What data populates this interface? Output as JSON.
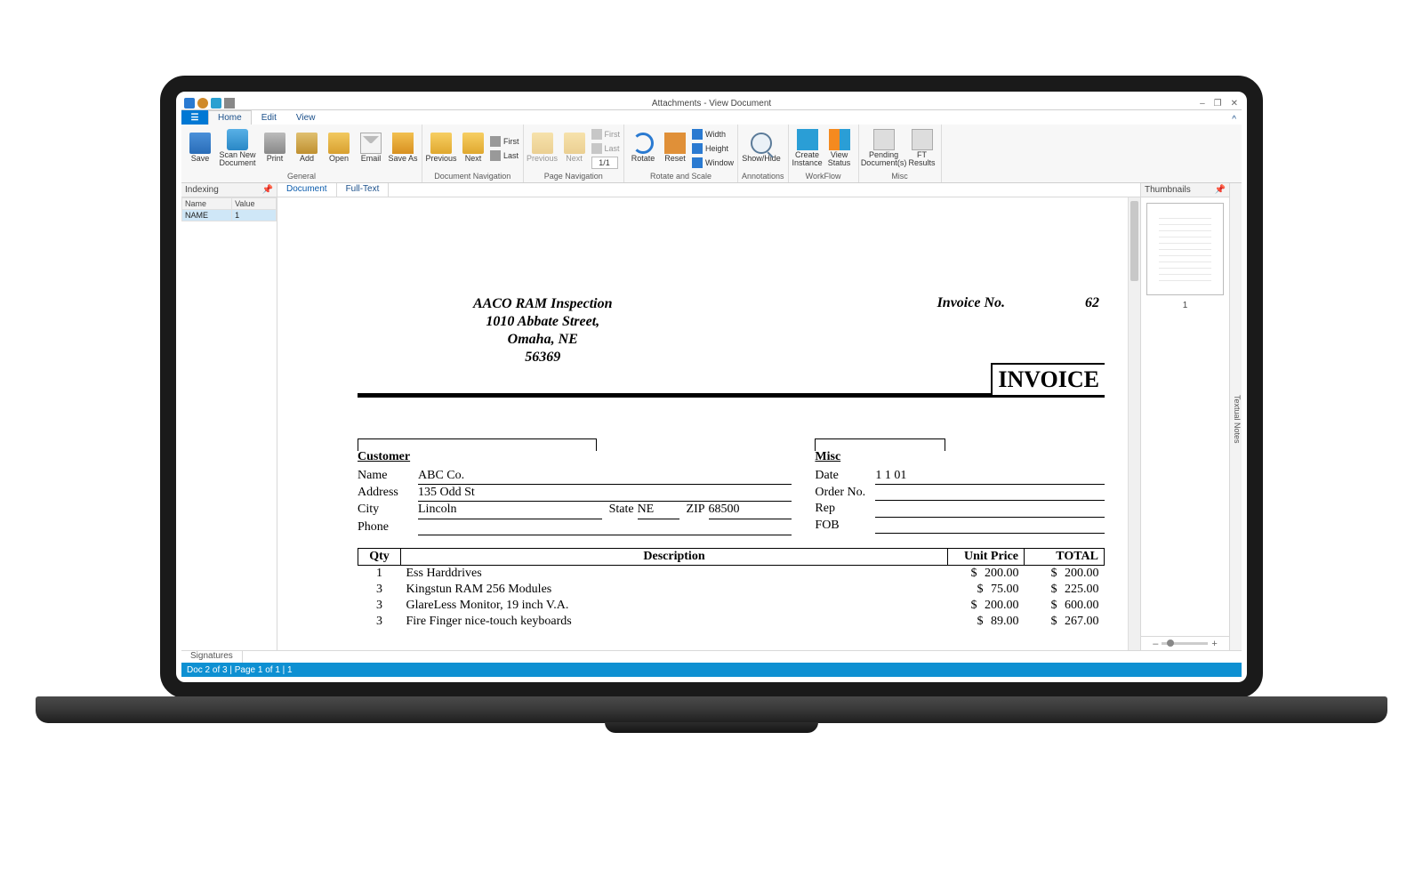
{
  "window": {
    "title": "Attachments - View Document",
    "minimize": "–",
    "maximize": "❐",
    "close": "✕",
    "help_icon": "^"
  },
  "ribbon": {
    "tabs": {
      "home": "Home",
      "edit": "Edit",
      "view": "View"
    },
    "general": {
      "label": "General",
      "save": "Save",
      "scan_new_document": "Scan New\nDocument",
      "print": "Print",
      "add": "Add",
      "open": "Open",
      "email": "Email",
      "save_as": "Save As"
    },
    "doc_nav": {
      "label": "Document Navigation",
      "previous": "Previous",
      "next": "Next",
      "first": "First",
      "last": "Last"
    },
    "page_nav": {
      "label": "Page Navigation",
      "previous": "Previous",
      "next": "Next",
      "first": "First",
      "last": "Last",
      "counter": "1/1"
    },
    "rotate": {
      "label": "Rotate and Scale",
      "rotate": "Rotate",
      "reset": "Reset",
      "width": "Width",
      "height": "Height",
      "window": "Window"
    },
    "annotations": {
      "label": "Annotations",
      "show_hide": "Show/Hide"
    },
    "workflow": {
      "label": "WorkFlow",
      "create_instance": "Create\nInstance",
      "view_status": "View\nStatus"
    },
    "misc": {
      "label": "Misc",
      "pending_documents": "Pending\nDocument(s)",
      "ft_results": "FT\nResults"
    }
  },
  "left_panel": {
    "title": "Indexing",
    "cols": {
      "name": "Name",
      "value": "Value"
    },
    "rows": [
      {
        "name": "NAME",
        "value": "1"
      }
    ]
  },
  "center": {
    "tabs": {
      "document": "Document",
      "fulltext": "Full-Text"
    }
  },
  "right_panel": {
    "title": "Thumbnails",
    "thumb_label": "1",
    "side_tab": "Textual Notes"
  },
  "bottom_tabs": {
    "signatures": "Signatures"
  },
  "status": "Doc 2 of 3  |  Page 1 of 1  |  1",
  "zoom": {
    "minus": "–",
    "plus": "+"
  },
  "invoice": {
    "from": [
      "AACO RAM Inspection",
      "1010 Abbate Street,",
      "Omaha, NE",
      "56369"
    ],
    "invoice_no_label": "Invoice No.",
    "invoice_no": "62",
    "title": "INVOICE",
    "customer_header": "Customer",
    "misc_header": "Misc",
    "customer": {
      "name_l": "Name",
      "name_v": "ABC Co.",
      "address_l": "Address",
      "address_v": "135 Odd St",
      "city_l": "City",
      "city_v": "Lincoln",
      "state_l": "State",
      "state_v": "NE",
      "zip_l": "ZIP",
      "zip_v": "68500",
      "phone_l": "Phone",
      "phone_v": ""
    },
    "misc": {
      "date_l": "Date",
      "date_v": "1 1 01",
      "order_l": "Order No.",
      "order_v": "",
      "rep_l": "Rep",
      "rep_v": "",
      "fob_l": "FOB",
      "fob_v": ""
    },
    "table": {
      "headers": {
        "qty": "Qty",
        "desc": "Description",
        "unit": "Unit Price",
        "total": "TOTAL"
      },
      "rows": [
        {
          "qty": "1",
          "desc": "Ess Harddrives",
          "unit": "200.00",
          "total": "200.00"
        },
        {
          "qty": "3",
          "desc": "Kingstun RAM 256 Modules",
          "unit": "75.00",
          "total": "225.00"
        },
        {
          "qty": "3",
          "desc": "GlareLess Monitor, 19 inch V.A.",
          "unit": "200.00",
          "total": "600.00"
        },
        {
          "qty": "3",
          "desc": "Fire Finger nice-touch keyboards",
          "unit": "89.00",
          "total": "267.00"
        }
      ],
      "currency": "$"
    }
  }
}
